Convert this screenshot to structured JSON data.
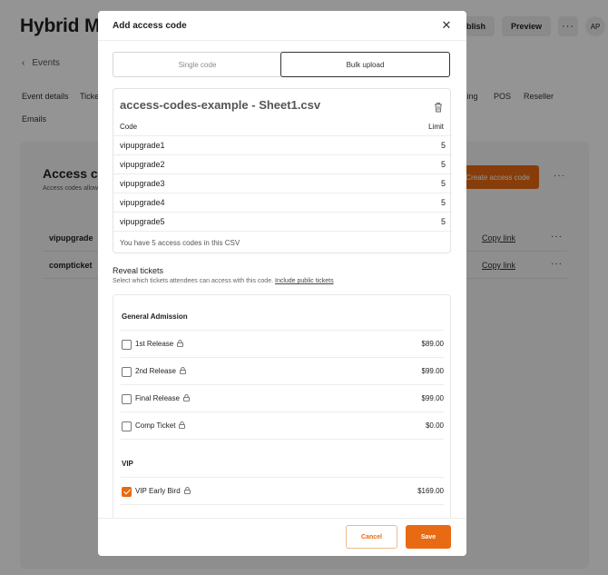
{
  "background": {
    "app_title": "Hybrid Min",
    "publish_label": "blish",
    "preview_label": "Preview",
    "more_label": "···",
    "avatar_initials": "AP",
    "back_label": "Events",
    "nav_items": [
      "Event details",
      "Ticke",
      "king",
      "POS",
      "Reseller",
      "Emails"
    ],
    "panel_title": "Access co",
    "panel_subtitle": "Access codes allow",
    "create_label": "Create access code",
    "rows": [
      {
        "name": "vipupgrade",
        "link": "Copy link"
      },
      {
        "name": "compticket",
        "link": "Copy link"
      }
    ]
  },
  "modal": {
    "title": "Add access code",
    "close_icon": "close-icon",
    "tabs": [
      {
        "label": "Single code",
        "active": false
      },
      {
        "label": "Bulk upload",
        "active": true
      }
    ],
    "csv": {
      "file_name": "access-codes-example - Sheet1.csv",
      "trash_icon": "trash-icon",
      "header_code": "Code",
      "header_limit": "Limit",
      "rows": [
        {
          "code": "vipupgrade1",
          "limit": "5"
        },
        {
          "code": "vipupgrade2",
          "limit": "5"
        },
        {
          "code": "vipupgrade3",
          "limit": "5"
        },
        {
          "code": "vipupgrade4",
          "limit": "5"
        },
        {
          "code": "vipupgrade5",
          "limit": "5"
        }
      ],
      "summary": "You have 5 access codes in this CSV"
    },
    "reveal": {
      "title": "Reveal tickets",
      "subtitle": "Select which tickets attendees can access with this code.",
      "link": "Include public tickets"
    },
    "groups": [
      {
        "name": "General Admission",
        "tickets": [
          {
            "name": "1st Release",
            "price": "$89.00",
            "checked": false
          },
          {
            "name": "2nd Release",
            "price": "$99.00",
            "checked": false
          },
          {
            "name": "Final Release",
            "price": "$99.00",
            "checked": false
          },
          {
            "name": "Comp Ticket",
            "price": "$0.00",
            "checked": false
          }
        ]
      },
      {
        "name": "VIP",
        "tickets": [
          {
            "name": "VIP Early Bird",
            "price": "$169.00",
            "checked": true
          }
        ]
      }
    ],
    "cancel_label": "Cancel",
    "save_label": "Save",
    "accent": "#e86a12"
  }
}
